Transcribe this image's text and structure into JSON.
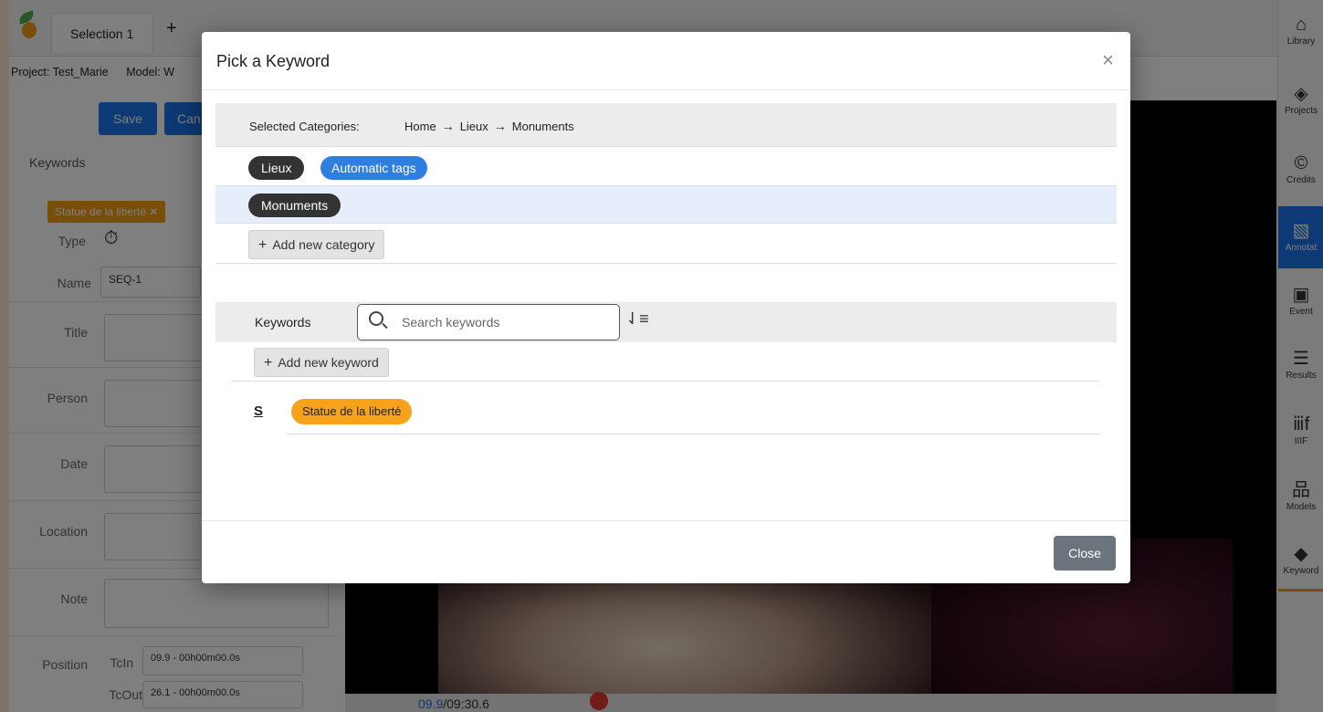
{
  "app": {
    "tab_label": "Selection 1",
    "tab_add": "+",
    "project": "Project: Test_Marie",
    "model": "Model: W",
    "save_label": "Save",
    "cancel_label": "Can",
    "keywords_label": "Keywords",
    "keyword_tag": "Statue de la liberté ✕",
    "fields": {
      "type": "Type",
      "name": "Name",
      "name_value": "SEQ-1",
      "title": "Title",
      "person": "Person",
      "date": "Date",
      "location": "Location",
      "note": "Note",
      "position": "Position",
      "tcin": "TcIn",
      "tcin_value": "09.9 - 00h00m00.0s",
      "tcout": "TcOut",
      "tcout_value": "26.1 - 00h00m00.0s"
    },
    "time_current": "09.9",
    "time_total": "/09:30.6",
    "video_controls": ")⊛⊛"
  },
  "sidebar": {
    "items": [
      {
        "label": "Library",
        "icon": "⌂"
      },
      {
        "label": "Projects",
        "icon": "◈"
      },
      {
        "label": "Credits",
        "icon": "©"
      },
      {
        "label": "Annotat",
        "icon": "▧"
      },
      {
        "label": "Event",
        "icon": "▣"
      },
      {
        "label": "Results",
        "icon": "☰"
      },
      {
        "label": "IIIF",
        "icon": "ⅲf"
      },
      {
        "label": "Models",
        "icon": "品"
      },
      {
        "label": "Keyword",
        "icon": "◆"
      }
    ]
  },
  "modal": {
    "title": "Pick a Keyword",
    "close_x": "×",
    "selected_categories_label": "Selected Categories:",
    "breadcrumb": [
      "Home",
      "Lieux",
      "Monuments"
    ],
    "breadcrumb_arrow": "→",
    "category_chips": [
      "Lieux",
      "Automatic tags"
    ],
    "selected_category": "Monuments",
    "add_category_label": "Add new category",
    "keywords_label": "Keywords",
    "search_placeholder": "Search keywords",
    "sort_icon": "⇃≡",
    "add_keyword_label": "Add new keyword",
    "letter_group": "S",
    "keyword_result": "Statue de la liberté",
    "close_button": "Close"
  },
  "colors": {
    "primary": "#1a73e8",
    "chip_blue": "#2e7fe0",
    "chip_dark": "#333333",
    "keyword_orange": "#f7a21b",
    "close_grey": "#6c757d",
    "page_bg": "#fbe7cf"
  }
}
